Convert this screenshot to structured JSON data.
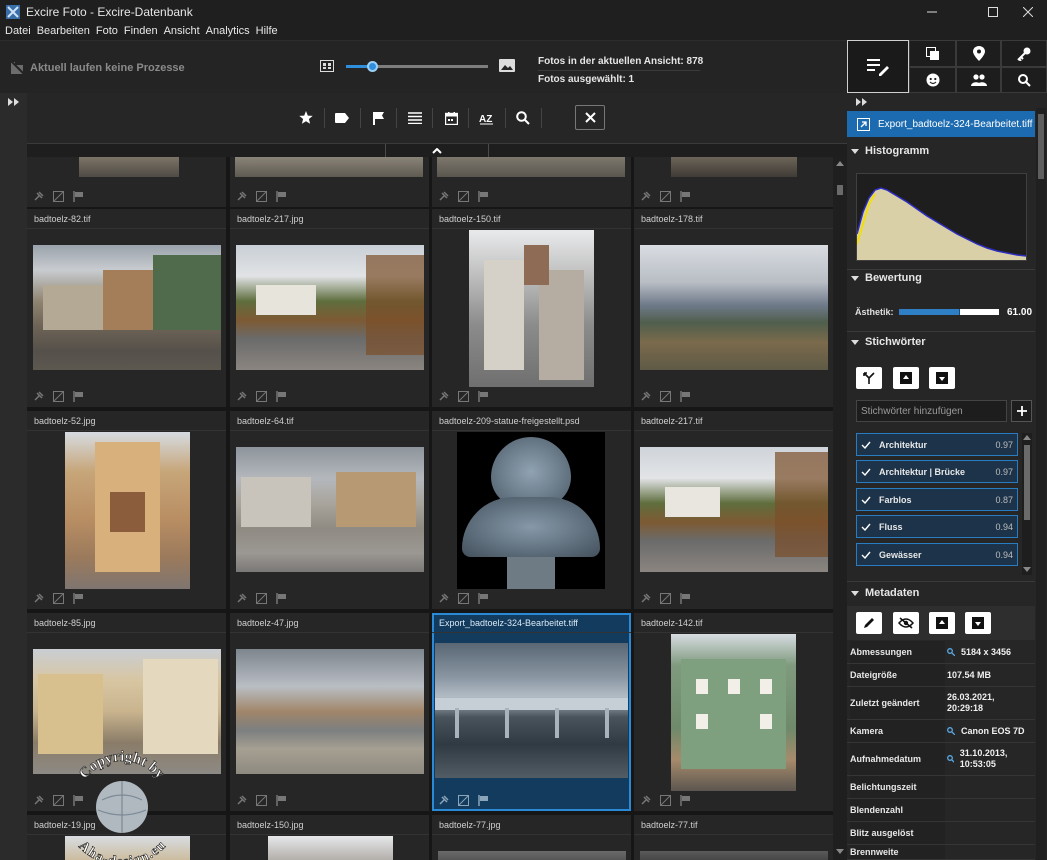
{
  "window": {
    "title": "Excire Foto - Excire-Datenbank"
  },
  "menu": [
    "Datei",
    "Bearbeiten",
    "Foto",
    "Finden",
    "Ansicht",
    "Analytics",
    "Hilfe"
  ],
  "toolbar": {
    "process_status": "Aktuell laufen keine Prozesse",
    "zoom_level": 0.18,
    "photos_in_view": "Fotos in der aktuellen Ansicht: 878",
    "photos_selected": "Fotos ausgewählt: 1"
  },
  "filter_icons": [
    "star-icon",
    "tag-icon",
    "flag-icon",
    "list-icon",
    "calendar-icon",
    "sort-az-icon",
    "search-icon",
    "close-icon"
  ],
  "grid": {
    "rows": [
      [
        {
          "name": ""
        },
        {
          "name": ""
        },
        {
          "name": ""
        },
        {
          "name": ""
        }
      ],
      [
        {
          "name": "badtoelz-82.tif"
        },
        {
          "name": "badtoelz-217.jpg"
        },
        {
          "name": "badtoelz-150.tif"
        },
        {
          "name": "badtoelz-178.tif"
        }
      ],
      [
        {
          "name": "badtoelz-52.jpg"
        },
        {
          "name": "badtoelz-64.tif"
        },
        {
          "name": "badtoelz-209-statue-freigestellt.psd"
        },
        {
          "name": "badtoelz-217.tif"
        }
      ],
      [
        {
          "name": "badtoelz-85.jpg"
        },
        {
          "name": "badtoelz-47.jpg"
        },
        {
          "name": "Export_badtoelz-324-Bearbeitet.tiff",
          "selected": true
        },
        {
          "name": "badtoelz-142.tif"
        }
      ],
      [
        {
          "name": "badtoelz-19.jpg"
        },
        {
          "name": "badtoelz-150.jpg"
        },
        {
          "name": "badtoelz-77.jpg"
        },
        {
          "name": "badtoelz-77.tif"
        }
      ]
    ]
  },
  "right_panel": {
    "file_name": "Export_badtoelz-324-Bearbeitet.tiff",
    "sections": {
      "histogram": "Histogramm",
      "rating": "Bewertung",
      "keywords": "Stichwörter",
      "metadata": "Metadaten"
    },
    "rating": {
      "label": "Ästhetik:",
      "value": "61.00",
      "fraction": 0.61
    },
    "keyword_input_placeholder": "Stichwörter hinzufügen",
    "keywords": [
      {
        "label": "Architektur",
        "score": "0.97"
      },
      {
        "label": "Architektur | Brücke",
        "score": "0.97"
      },
      {
        "label": "Farblos",
        "score": "0.87"
      },
      {
        "label": "Fluss",
        "score": "0.94"
      },
      {
        "label": "Gewässer",
        "score": "0.94"
      }
    ],
    "metadata": [
      {
        "key": "Abmessungen",
        "value": "5184 x 3456",
        "search": true
      },
      {
        "key": "Dateigröße",
        "value": "107.54 MB",
        "search": false
      },
      {
        "key": "Zuletzt geändert",
        "value": "26.03.2021, 20:29:18",
        "search": false
      },
      {
        "key": "Kamera",
        "value": "Canon EOS 7D",
        "search": true
      },
      {
        "key": "Aufnahmedatum",
        "value": "31.10.2013, 10:53:05",
        "search": true
      },
      {
        "key": "Belichtungszeit",
        "value": "",
        "search": false
      },
      {
        "key": "Blendenzahl",
        "value": "",
        "search": false
      },
      {
        "key": "Blitz ausgelöst",
        "value": "",
        "search": false
      },
      {
        "key": "Brennweite",
        "value": "",
        "search": false
      }
    ]
  },
  "watermark": {
    "line1": "Copyright by",
    "line2": "Aha-design.eu"
  },
  "colors": {
    "accent": "#1c6bb0",
    "selection": "#2a8ad6",
    "background": "#1b1b1b"
  }
}
